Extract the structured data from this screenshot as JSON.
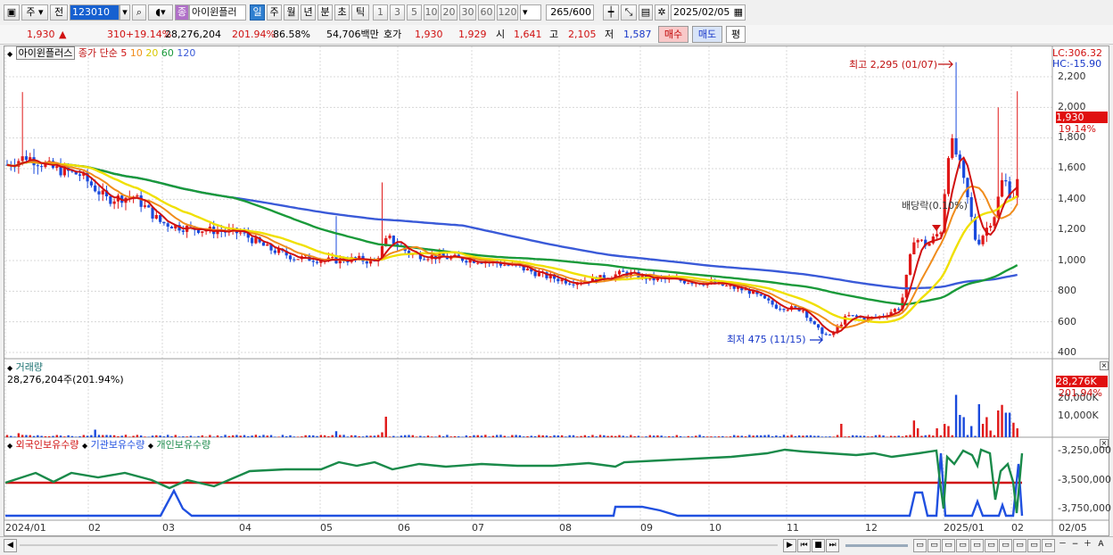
{
  "toolbar": {
    "market": "주",
    "prev": "전",
    "code": "123010",
    "stock_name": "아이윈플러",
    "badge": "종",
    "periods": [
      "일",
      "주",
      "월",
      "년",
      "분",
      "초",
      "틱"
    ],
    "active_period": "일",
    "minutes": [
      "1",
      "3",
      "5",
      "10",
      "20",
      "30",
      "60",
      "120"
    ],
    "count": "265",
    "count_max": "/600",
    "date": "2025/02/05"
  },
  "quote": {
    "price": "1,930",
    "arrow": "▲",
    "change": "310",
    "change_pct": "+19.14%",
    "volume": "28,276,204",
    "vol_ratio": "201.94%",
    "turnover": "86.58%",
    "amount": "54,706백만",
    "bid_label": "호가",
    "ask": "1,930",
    "bid": "1,929",
    "open_label": "시",
    "open": "1,641",
    "high_label": "고",
    "high": "2,105",
    "low_label": "저",
    "low": "1,587",
    "buy_label": "매수",
    "sell_label": "매도",
    "eval_label": "평"
  },
  "price_panel": {
    "name": "아이윈플러스",
    "ma_title": "종가 단순",
    "ma_periods": [
      "5",
      "10",
      "20",
      "60",
      "120"
    ],
    "ma_colors": [
      "#d01010",
      "#f08c1c",
      "#e8d800",
      "#1a9a3a",
      "#3a5ad8"
    ],
    "lc": "LC:306.32",
    "hc": "HC:-15.90",
    "high_annot": "최고 2,295 (01/07)",
    "low_annot": "최저 475 (11/15)",
    "div_annot": "배당락(0.10%)",
    "y_labels": [
      "2,200",
      "2,000",
      "1,800",
      "1,600",
      "1,400",
      "1,200",
      "1,000",
      "800",
      "600",
      "400"
    ],
    "cur_price": "1,930",
    "cur_pct": "19.14%"
  },
  "volume_panel": {
    "title": "거래량",
    "value_text": "28,276,204주(201.94%)",
    "y_labels": [
      "20,000K",
      "10,000K"
    ],
    "cur_value": "28,276K",
    "cur_pct": "201.94%"
  },
  "holdings_panel": {
    "legend": [
      "외국인보유수량",
      "기관보유수량",
      "개인보유수량"
    ],
    "colors": [
      "#d01010",
      "#2050e0",
      "#1a8a4a"
    ],
    "y_labels": [
      "-3,250,000",
      "-3,500,000",
      "-3,750,000"
    ]
  },
  "x_axis": [
    "2024/01",
    "02",
    "03",
    "04",
    "05",
    "06",
    "07",
    "08",
    "09",
    "10",
    "11",
    "12",
    "2025/01",
    "02",
    "02/05"
  ],
  "chart_data": {
    "type": "candlestick",
    "ylim": [
      400,
      2300
    ],
    "annotations": {
      "high": 2295,
      "high_date": "01/07",
      "low": 475,
      "low_date": "11/15"
    },
    "moving_averages": [
      5,
      10,
      20,
      60,
      120
    ],
    "last_close": 1930,
    "last_volume_k": 28276
  }
}
